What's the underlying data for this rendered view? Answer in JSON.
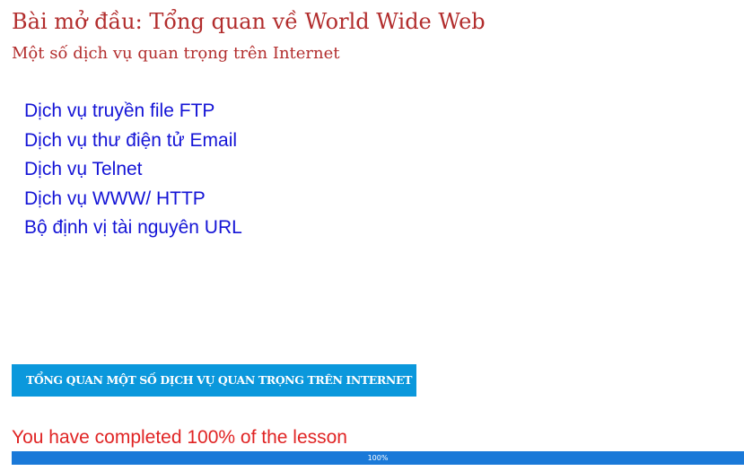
{
  "lesson": {
    "title": "Bài mở đầu: Tổng quan về World Wide Web",
    "subtitle": "Một số dịch vụ quan trọng trên Internet"
  },
  "services": {
    "items": [
      {
        "label": "Dịch vụ truyền file FTP"
      },
      {
        "label": "Dịch vụ thư điện tử Email"
      },
      {
        "label": "Dịch vụ Telnet"
      },
      {
        "label": "Dịch vụ WWW/ HTTP"
      },
      {
        "label": "Bộ định vị tài nguyên URL"
      }
    ]
  },
  "overview_button": {
    "label": "TỔNG QUAN MỘT SỐ DỊCH VỤ QUAN TRỌNG TRÊN INTERNET"
  },
  "progress": {
    "message": "You have completed 100% of the lesson",
    "label": "100%",
    "percent": 100
  },
  "colors": {
    "heading": "#b22d2d",
    "link": "#1414d6",
    "button_bg": "#0b98dc",
    "completion_text": "#e02424",
    "progress_fill": "#1a79d8"
  }
}
